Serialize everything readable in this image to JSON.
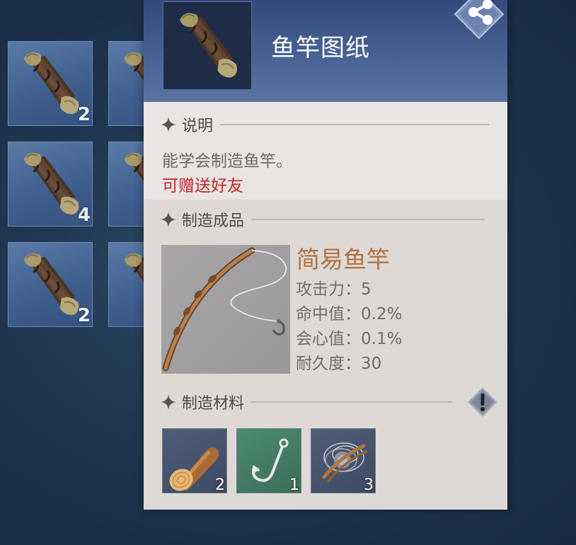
{
  "inventory": {
    "slots": [
      {
        "icon": "scroll-icon",
        "count": "2"
      },
      {
        "icon": "scroll-icon",
        "count": ""
      },
      {
        "icon": "scroll-icon",
        "count": "4"
      },
      {
        "icon": "scroll-icon",
        "count": ""
      },
      {
        "icon": "scroll-icon",
        "count": "2"
      },
      {
        "icon": "scroll-icon",
        "count": ""
      }
    ]
  },
  "item": {
    "title": "鱼竿图纸",
    "icon": "scroll-icon",
    "share_icon": "share-icon"
  },
  "description": {
    "header": "说明",
    "text": "能学会制造鱼竿。",
    "gift_text": "可赠送好友",
    "gift_color": "#c8242e"
  },
  "product": {
    "header": "制造成品",
    "name": "简易鱼竿",
    "name_color": "#b07244",
    "icon": "fishing-rod-icon",
    "stats": [
      {
        "label": "攻击力：5"
      },
      {
        "label": "命中值：0.2%"
      },
      {
        "label": "会心值：0.1%"
      },
      {
        "label": "耐久度：30"
      }
    ]
  },
  "materials": {
    "header": "制造材料",
    "info_icon": "exclamation-icon",
    "items": [
      {
        "icon": "log-icon",
        "count": "2"
      },
      {
        "icon": "fishhook-icon",
        "count": "1"
      },
      {
        "icon": "fishing-line-icon",
        "count": "3"
      }
    ]
  }
}
